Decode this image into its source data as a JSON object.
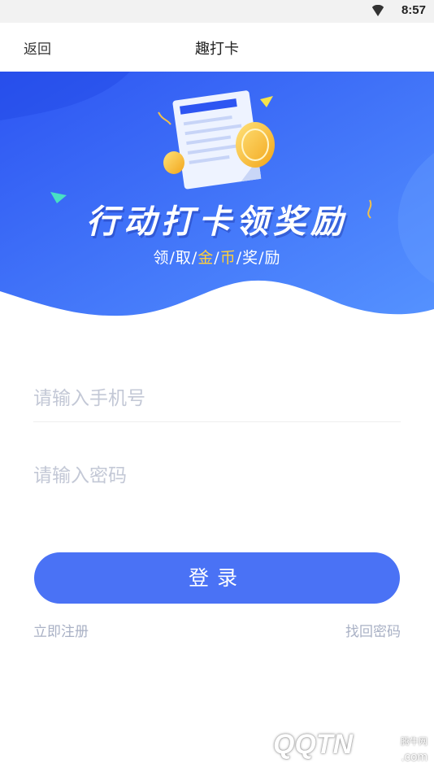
{
  "status_bar": {
    "time": "8:57",
    "wifi_icon": "wifi-icon"
  },
  "nav": {
    "back_label": "返回",
    "title": "趣打卡"
  },
  "banner": {
    "title": "行动打卡领奖励",
    "subtitle_parts": [
      "领",
      "取",
      "金",
      "币",
      "奖",
      "励"
    ],
    "subtitle_separator": "/",
    "colors": {
      "gradient_start": "#2f5cf5",
      "gradient_end": "#4f8bff",
      "gold": "#ffcf3a"
    },
    "illustration": "document-with-coins"
  },
  "form": {
    "phone_placeholder": "请输入手机号",
    "phone_value": "",
    "password_placeholder": "请输入密码",
    "password_value": "",
    "login_label": "登录",
    "register_link": "立即注册",
    "forgot_link": "找回密码",
    "accent_color": "#4a72f5"
  },
  "watermark": {
    "logo": "QQTN",
    "cn": "腾牛网",
    "domain": ".com"
  }
}
